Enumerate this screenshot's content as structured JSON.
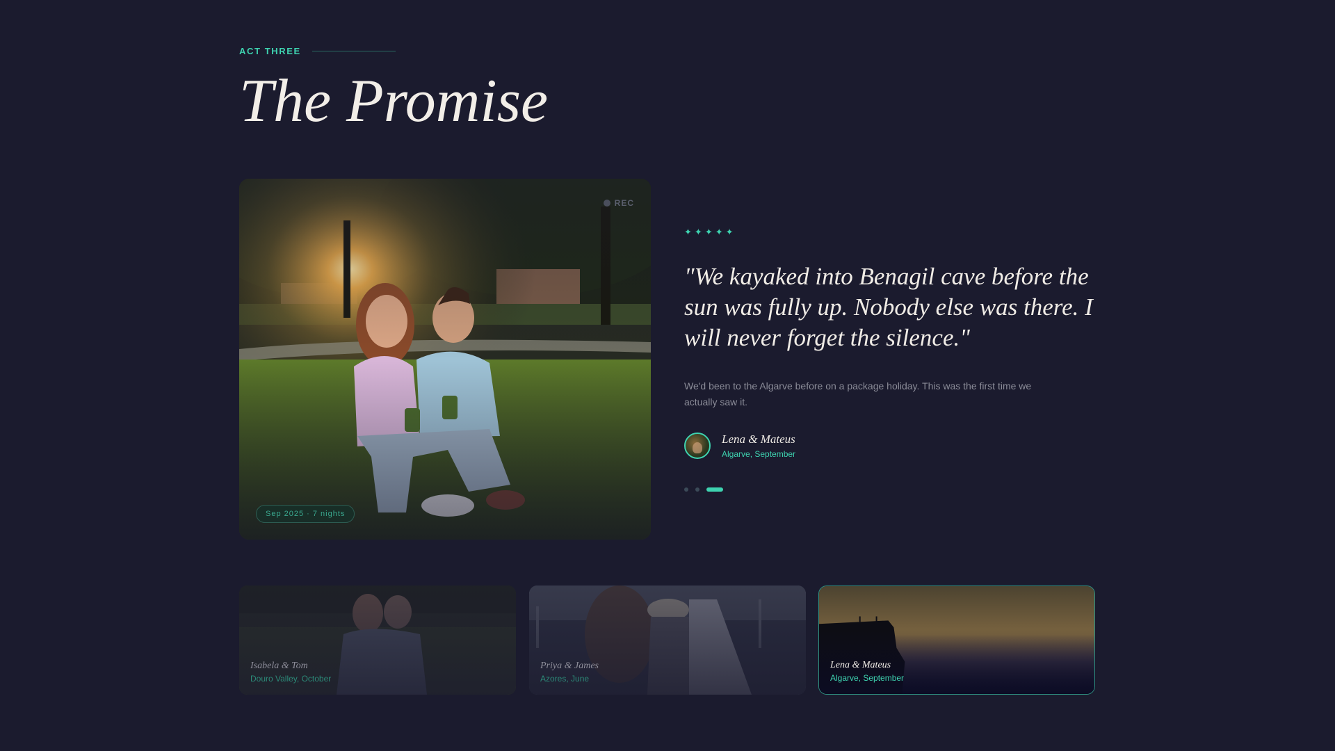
{
  "section": {
    "eyebrow": "ACT THREE",
    "title": "The Promise"
  },
  "photo": {
    "rec_label": "REC",
    "date_badge": "Sep 2025 · 7 nights"
  },
  "testimonial": {
    "rating": 5,
    "stars": [
      "✦",
      "✦",
      "✦",
      "✦",
      "✦"
    ],
    "quote": "\"We kayaked into Benagil cave before the sun was fully up. Nobody else was there. I will never forget the silence.\"",
    "body": "We'd been to the Algarve before on a package holiday. This was the first time we actually saw it.",
    "author_name": "Lena & Mateus",
    "author_place": "Algarve, September"
  },
  "pagination": {
    "count": 3,
    "active_index": 2
  },
  "thumbnails": [
    {
      "name": "Isabela & Tom",
      "place": "Douro Valley, October",
      "active": false
    },
    {
      "name": "Priya & James",
      "place": "Azores, June",
      "active": false
    },
    {
      "name": "Lena & Mateus",
      "place": "Algarve, September",
      "active": true
    }
  ],
  "colors": {
    "background": "#1b1b2e",
    "accent": "#3ed3b0",
    "text": "#f0ece6",
    "muted": "#8b8c98"
  }
}
